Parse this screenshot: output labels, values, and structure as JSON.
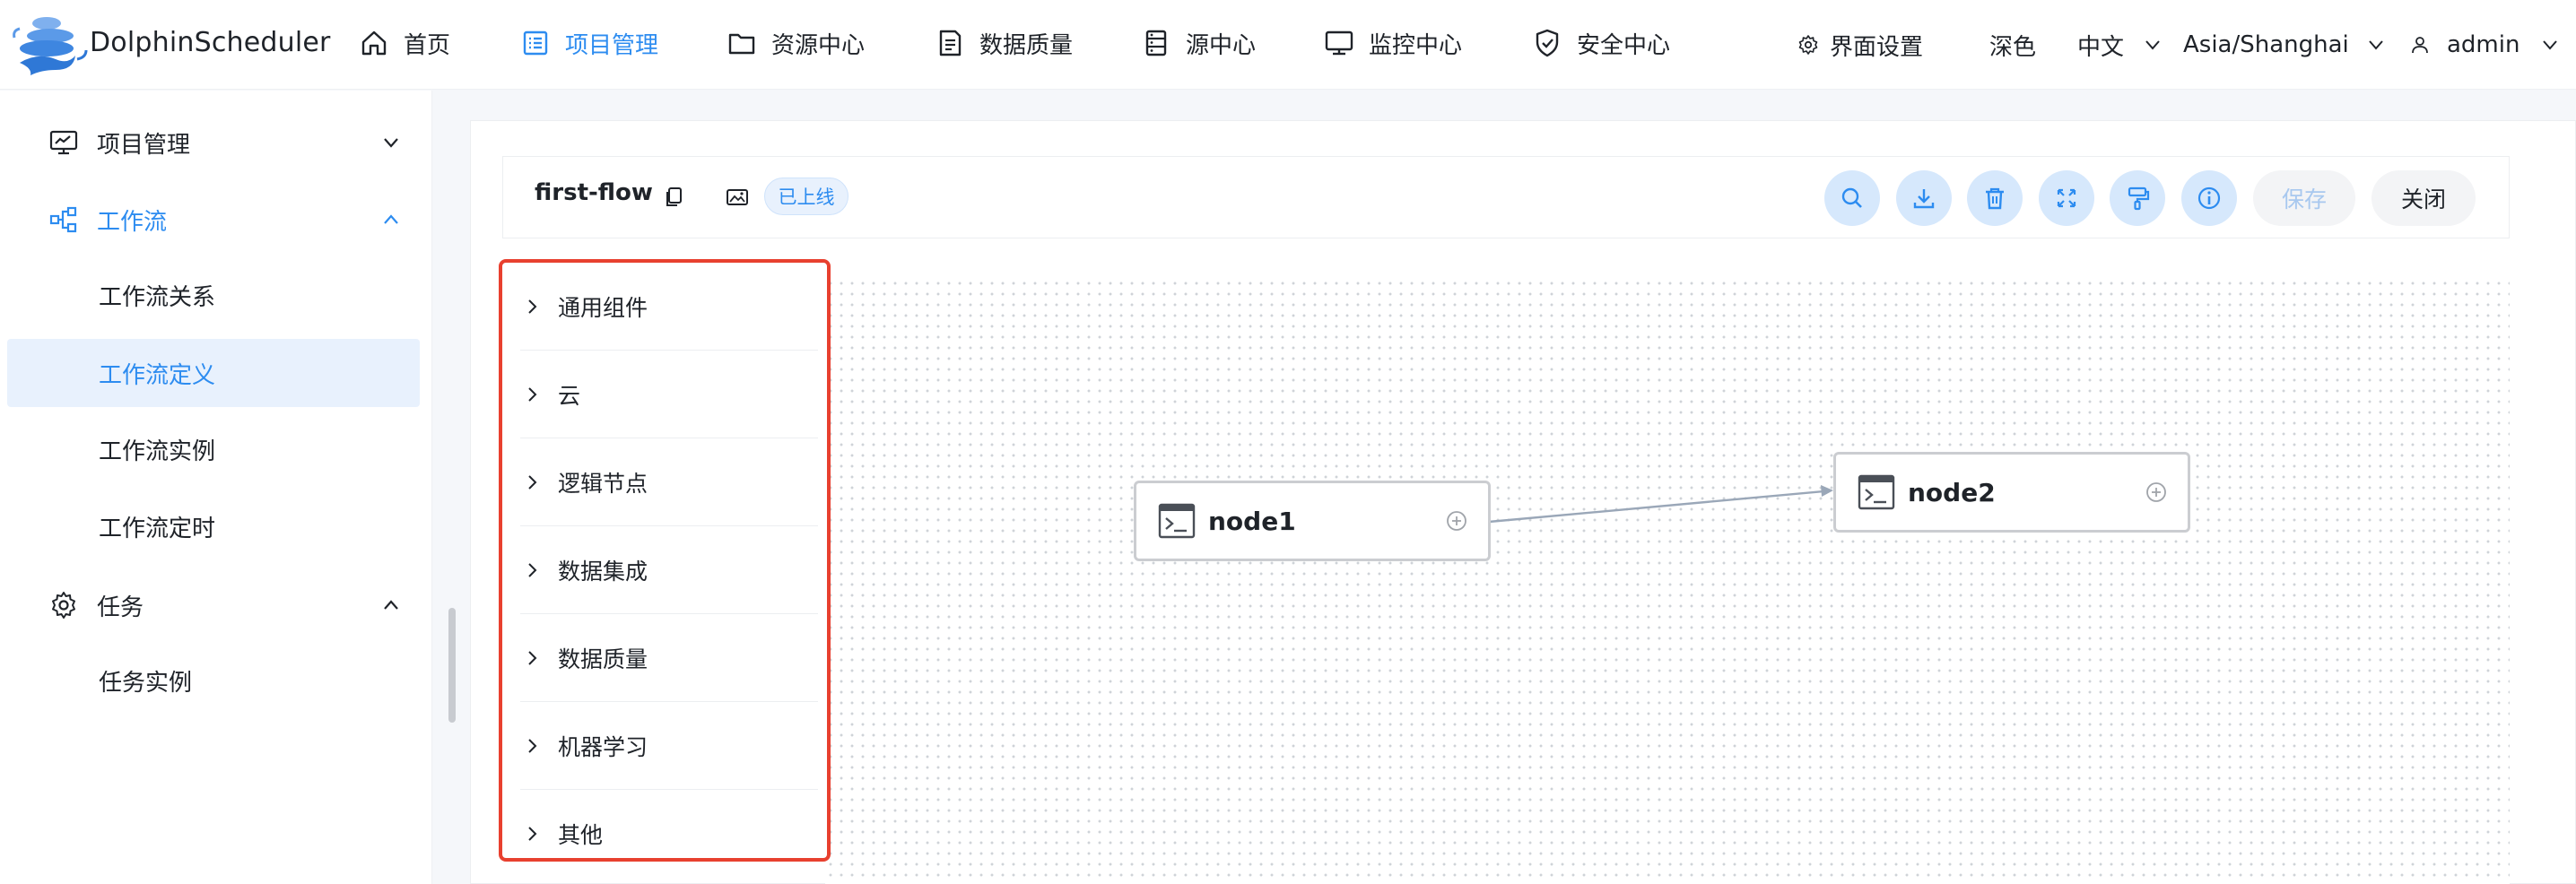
{
  "app": {
    "brand": "DolphinScheduler"
  },
  "nav": [
    {
      "label": "首页",
      "icon": "home-icon"
    },
    {
      "label": "项目管理",
      "icon": "project-icon",
      "active": true
    },
    {
      "label": "资源中心",
      "icon": "folder-icon"
    },
    {
      "label": "数据质量",
      "icon": "data-quality-icon"
    },
    {
      "label": "源中心",
      "icon": "datasource-icon"
    },
    {
      "label": "监控中心",
      "icon": "monitor-icon"
    },
    {
      "label": "安全中心",
      "icon": "shield-icon"
    }
  ],
  "header_right": {
    "settings_label": "界面设置",
    "theme_label": "深色",
    "language_label": "中文",
    "timezone_label": "Asia/Shanghai",
    "user_label": "admin"
  },
  "sidebar": {
    "groups": [
      {
        "label": "项目管理",
        "icon": "project-overview-icon",
        "expanded": false
      },
      {
        "label": "工作流",
        "icon": "workflow-icon",
        "expanded": true,
        "active": true
      },
      {
        "label": "任务",
        "icon": "gear-icon",
        "expanded": true
      }
    ],
    "workflow_items": [
      "工作流关系",
      "工作流定义",
      "工作流实例",
      "工作流定时"
    ],
    "active_item": "工作流定义",
    "task_items": [
      "任务实例"
    ]
  },
  "editor": {
    "title": "first-flow",
    "status_tag": "已上线",
    "save_label": "保存",
    "close_label": "关闭",
    "toolbar_icons": [
      "search-icon",
      "download-icon",
      "delete-icon",
      "fullscreen-icon",
      "format-icon",
      "info-icon"
    ]
  },
  "panel": {
    "items": [
      "通用组件",
      "云",
      "逻辑节点",
      "数据集成",
      "数据质量",
      "机器学习",
      "其他"
    ]
  },
  "dag": {
    "nodes": [
      {
        "label": "node1",
        "icon": "shell-icon"
      },
      {
        "label": "node2",
        "icon": "shell-icon"
      }
    ],
    "edges": [
      {
        "from": "node1",
        "to": "node2"
      }
    ]
  },
  "colors": {
    "accent": "#2d8cf0",
    "highlight_border": "#e8402f",
    "active_bg": "#e8f1fd"
  }
}
